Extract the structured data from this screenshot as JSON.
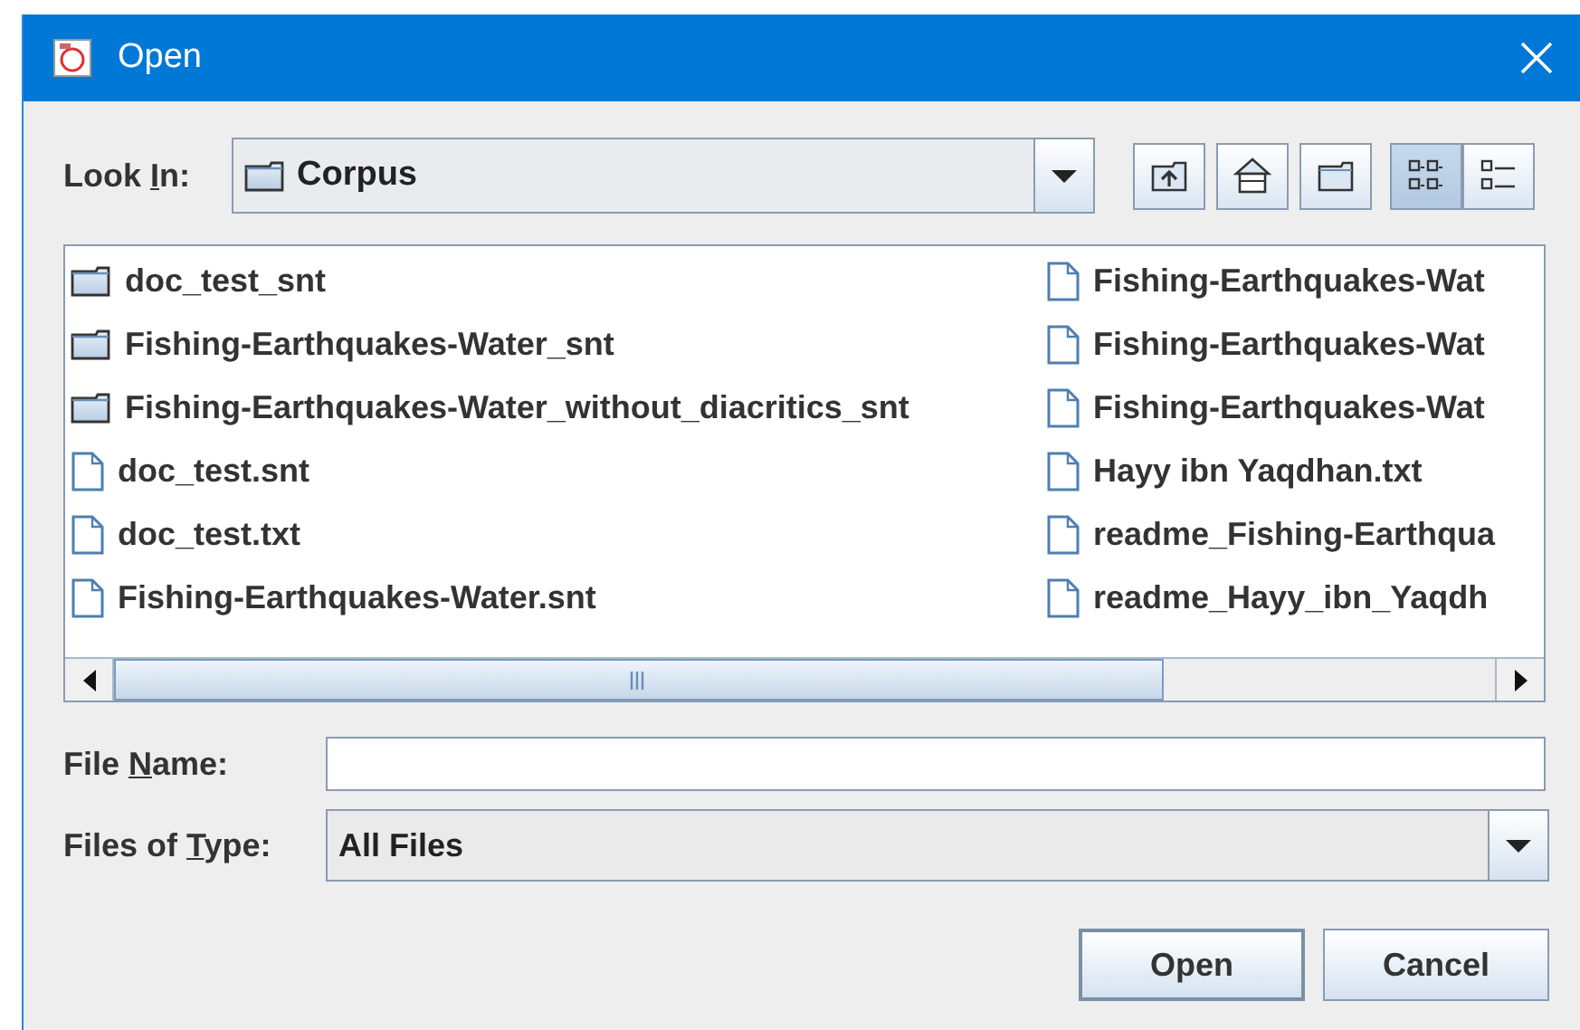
{
  "window": {
    "title": "Open"
  },
  "look_in": {
    "label": {
      "before": "Look ",
      "key": "I",
      "after": "n:"
    },
    "value": "Corpus"
  },
  "toolbar": [
    {
      "kind": "up"
    },
    {
      "kind": "home"
    },
    {
      "kind": "new-folder"
    },
    {
      "kind": "list-view",
      "selected": true
    },
    {
      "kind": "details-view",
      "selected": false
    }
  ],
  "files": [
    {
      "kind": "folder",
      "name": "doc_test_snt"
    },
    {
      "kind": "folder",
      "name": "Fishing-Earthquakes-Water_snt"
    },
    {
      "kind": "folder",
      "name": "Fishing-Earthquakes-Water_without_diacritics_snt"
    },
    {
      "kind": "file",
      "name": "doc_test.snt"
    },
    {
      "kind": "file",
      "name": "doc_test.txt"
    },
    {
      "kind": "file",
      "name": "Fishing-Earthquakes-Water.snt"
    },
    {
      "kind": "file",
      "name": "Fishing-Earthquakes-Wat"
    },
    {
      "kind": "file",
      "name": "Fishing-Earthquakes-Wat"
    },
    {
      "kind": "file",
      "name": "Fishing-Earthquakes-Wat"
    },
    {
      "kind": "file",
      "name": "Hayy ibn Yaqdhan.txt"
    },
    {
      "kind": "file",
      "name": "readme_Fishing-Earthqua"
    },
    {
      "kind": "file",
      "name": "readme_Hayy_ibn_Yaqdh"
    }
  ],
  "file_name": {
    "label": {
      "before": "File ",
      "key": "N",
      "after": "ame:"
    }
  },
  "file_type": {
    "label": {
      "before": "Files of ",
      "key": "T",
      "after": "ype:"
    },
    "value": "All Files"
  },
  "buttons": [
    "Open",
    "Cancel"
  ]
}
